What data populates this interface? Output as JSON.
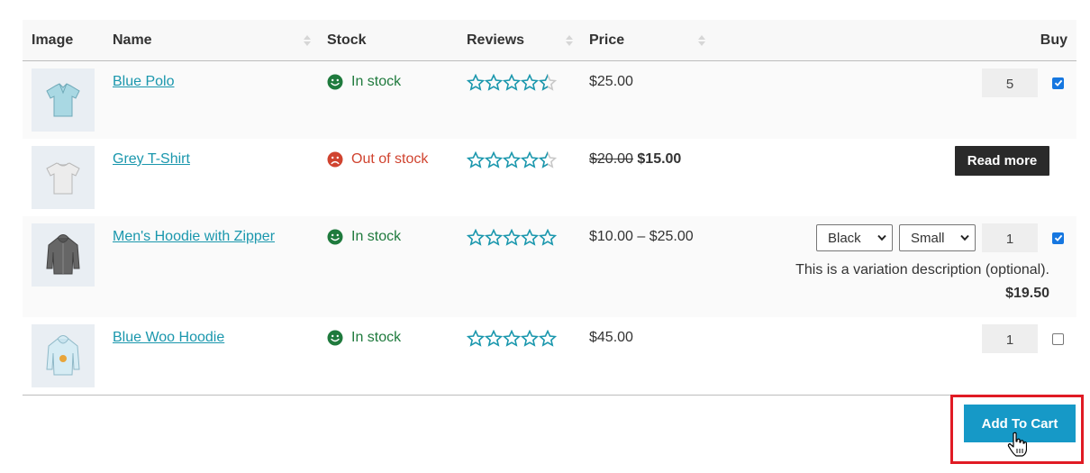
{
  "table": {
    "headers": {
      "image": "Image",
      "name": "Name",
      "stock": "Stock",
      "reviews": "Reviews",
      "price": "Price",
      "buy": "Buy"
    },
    "rows": [
      {
        "name": "Blue Polo",
        "stock": "In stock",
        "stock_status": "in",
        "rating": 4.5,
        "price": "$25.00",
        "quantity": "5",
        "checked": true,
        "thumb_icon": "polo-shirt-icon"
      },
      {
        "name": "Grey T-Shirt",
        "stock": "Out of stock",
        "stock_status": "out",
        "rating": 4.5,
        "price_old": "$20.00",
        "price_new": "$15.00",
        "button": "Read more",
        "thumb_icon": "t-shirt-icon"
      },
      {
        "name": "Men's Hoodie with Zipper",
        "stock": "In stock",
        "stock_status": "in",
        "rating": 5,
        "price": "$10.00 – $25.00",
        "color_select": "Black",
        "size_select": "Small",
        "quantity": "1",
        "checked": true,
        "variation_description": "This is a variation description (optional).",
        "variation_price": "$19.50",
        "thumb_icon": "hoodie-icon"
      },
      {
        "name": "Blue Woo Hoodie",
        "stock": "In stock",
        "stock_status": "in",
        "rating": 5,
        "price": "$45.00",
        "quantity": "1",
        "checked": false,
        "thumb_icon": "hoodie-icon"
      }
    ]
  },
  "cart_button": "Add To Cart",
  "colors": {
    "link": "#1a97ad",
    "in_stock": "#1f7a3d",
    "out_of_stock": "#d0432f",
    "cart_button": "#1699c7",
    "highlight": "#e01b24",
    "star": "#1a97ad"
  }
}
